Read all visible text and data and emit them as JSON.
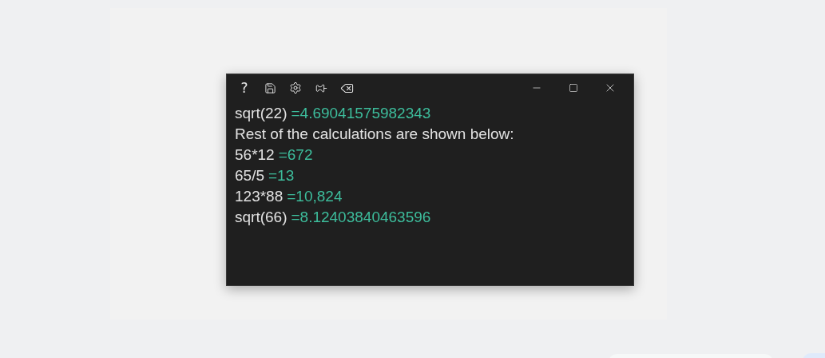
{
  "toolbar": {
    "help": "?"
  },
  "lines": [
    {
      "kind": "calc",
      "expression": "sqrt(22)",
      "result": "=4.69041575982343"
    },
    {
      "kind": "text",
      "text": "Rest of the calculations are shown below:"
    },
    {
      "kind": "calc",
      "expression": "56*12",
      "result": "=672"
    },
    {
      "kind": "calc",
      "expression": "65/5",
      "result": "=13"
    },
    {
      "kind": "calc",
      "expression": "123*88",
      "result": "=10,824"
    },
    {
      "kind": "calc",
      "expression": "sqrt(66)",
      "result": "=8.12403840463596"
    }
  ]
}
